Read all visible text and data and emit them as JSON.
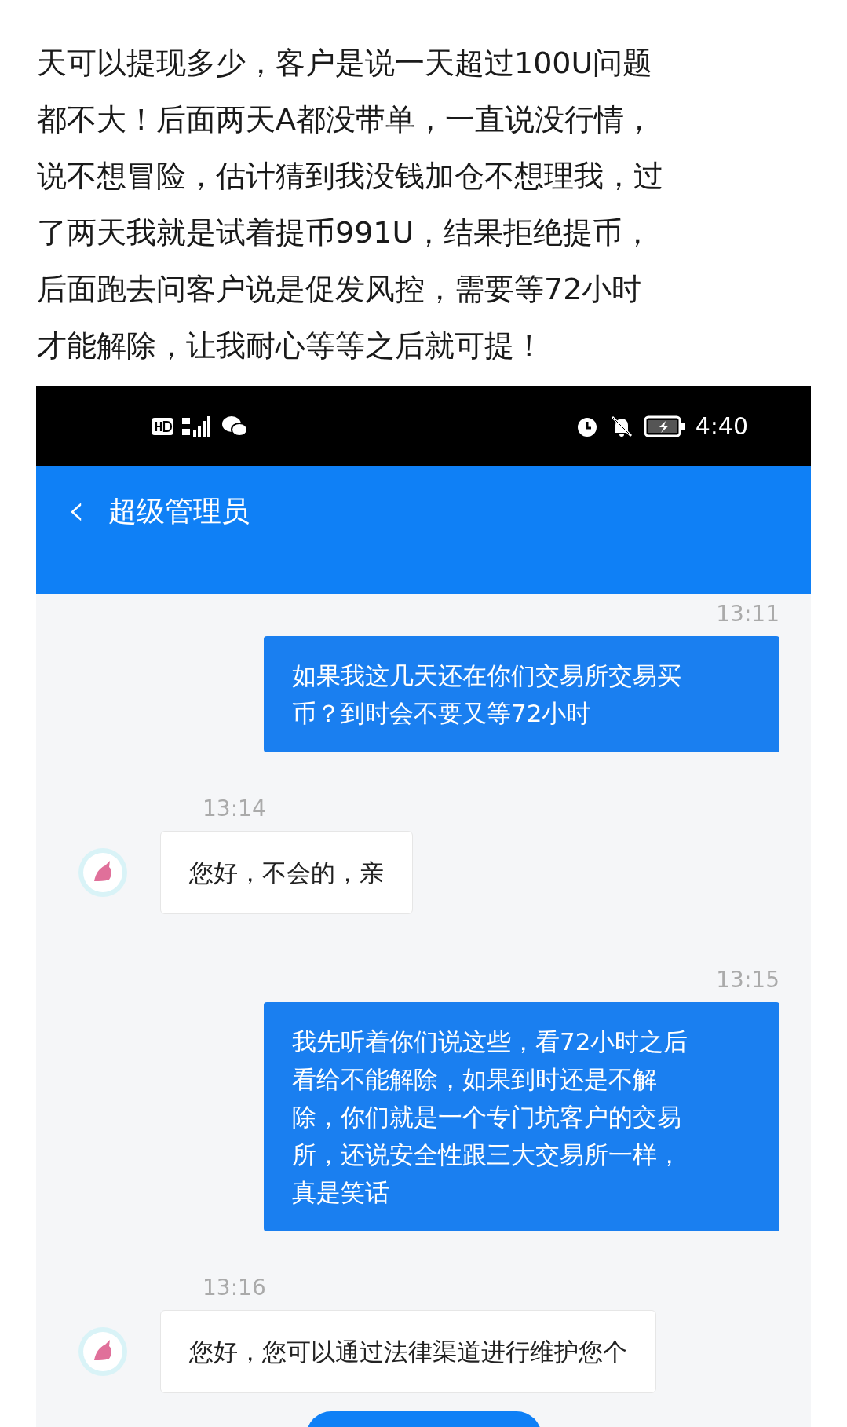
{
  "article": {
    "lines": [
      "天可以提现多少，客户是说一天超过100U问题",
      "都不大！后面两天A都没带单，一直说没行情，",
      "说不想冒险，估计猜到我没钱加仓不想理我，过",
      "了两天我就是试着提币991U，结果拒绝提币，",
      "后面跑去问客户说是促发风控，需要等72小时",
      "才能解除，让我耐心等等之后就可提！"
    ]
  },
  "phone": {
    "status_bar": {
      "time": "4:40"
    },
    "header": {
      "back": "‹",
      "title": "超级管理员"
    },
    "messages": [
      {
        "kind": "sent",
        "time": "13:11",
        "lines": [
          "如果我这几天还在你们交易所交易买",
          "币？到时会不要又等72小时"
        ]
      },
      {
        "kind": "received",
        "time": "13:14",
        "lines": [
          "您好，不会的，亲"
        ]
      },
      {
        "kind": "sent",
        "time": "13:15",
        "lines": [
          "我先听着你们说这些，看72小时之后",
          "看给不能解除，如果到时还是不解",
          "除，你们就是一个专门坑客户的交易",
          "所，还说安全性跟三大交易所一样，",
          "真是笑话"
        ]
      },
      {
        "kind": "received",
        "time": "13:16",
        "lines": [
          "您好，您可以通过法律渠道进行维护您个"
        ]
      }
    ]
  }
}
